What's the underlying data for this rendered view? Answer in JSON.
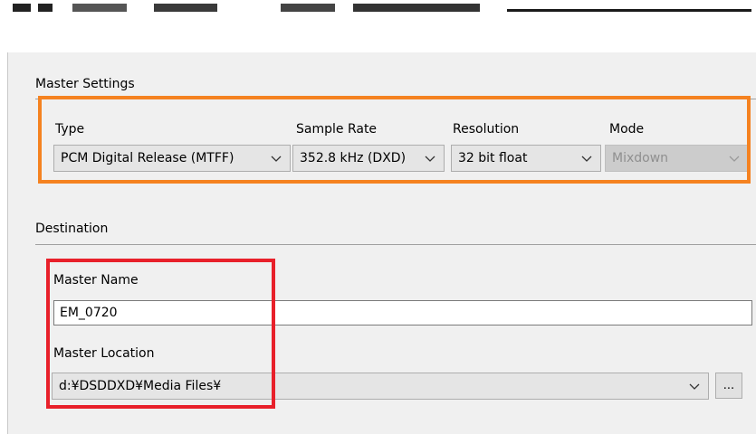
{
  "master_settings": {
    "title": "Master Settings",
    "type": {
      "label": "Type",
      "value": "PCM Digital Release (MTFF)"
    },
    "sample_rate": {
      "label": "Sample Rate",
      "value": "352.8 kHz (DXD)"
    },
    "resolution": {
      "label": "Resolution",
      "value": "32 bit float"
    },
    "mode": {
      "label": "Mode",
      "value": "Mixdown",
      "enabled": false
    }
  },
  "destination": {
    "title": "Destination",
    "master_name": {
      "label": "Master Name",
      "value": "EM_0720"
    },
    "master_location": {
      "label": "Master Location",
      "value": "d:¥DSDDXD¥Media Files¥"
    },
    "browse_label": "..."
  },
  "highlight_colors": {
    "orange": "#f58220",
    "red": "#e8202a"
  },
  "icons": {
    "dropdown": "chevron-down-icon"
  }
}
